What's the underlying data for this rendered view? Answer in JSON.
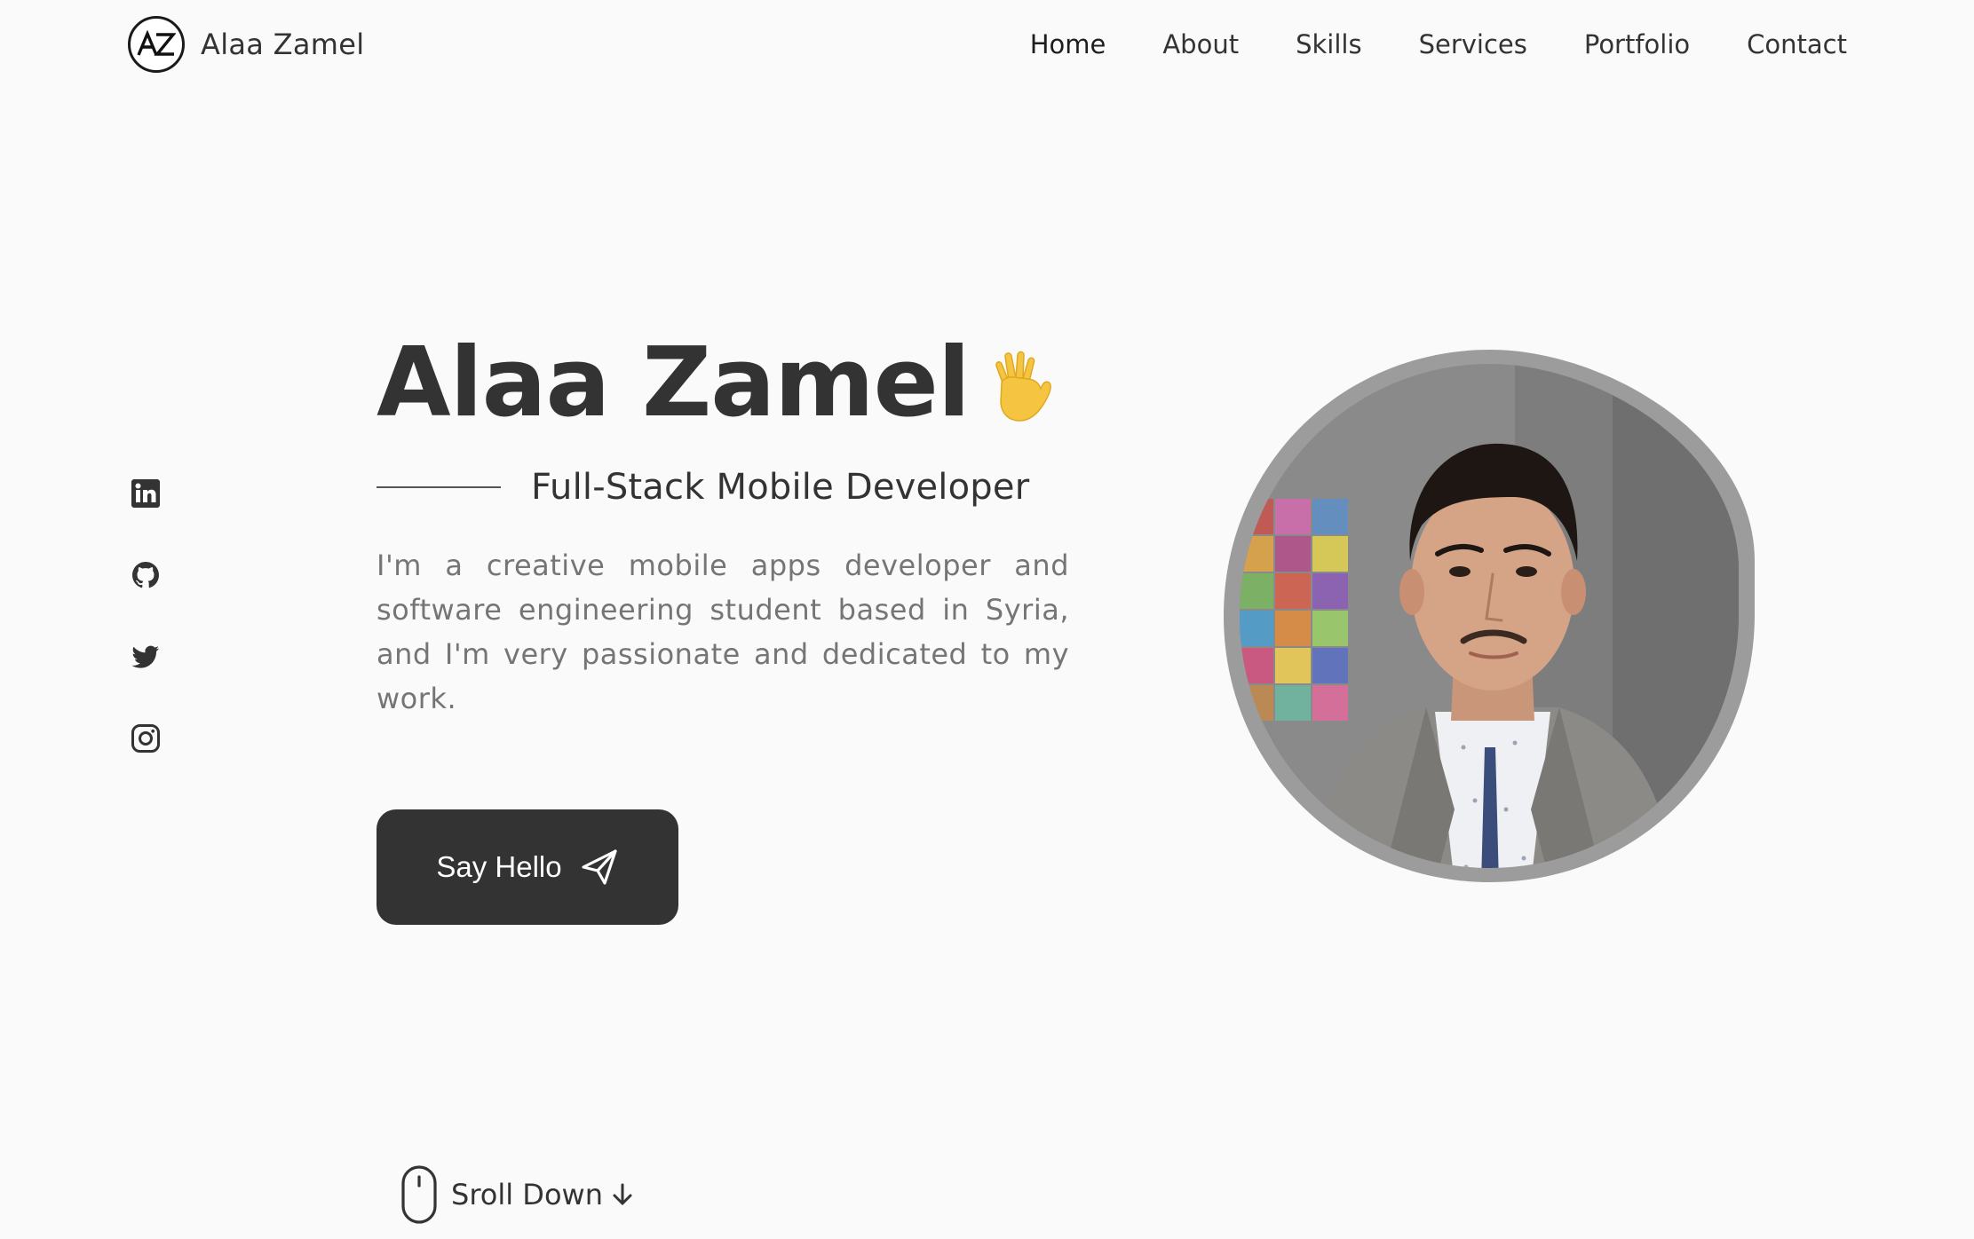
{
  "brand": {
    "logo_text": "AZ",
    "name": "Alaa Zamel"
  },
  "nav": {
    "items": [
      {
        "label": "Home",
        "active": true
      },
      {
        "label": "About",
        "active": false
      },
      {
        "label": "Skills",
        "active": false
      },
      {
        "label": "Services",
        "active": false
      },
      {
        "label": "Portfolio",
        "active": false
      },
      {
        "label": "Contact",
        "active": false
      }
    ]
  },
  "social": {
    "icons": [
      "linkedin-icon",
      "github-icon",
      "twitter-icon",
      "instagram-icon"
    ]
  },
  "hero": {
    "name": "Alaa Zamel",
    "wave_icon": "waving-hand-icon",
    "subtitle": "Full-Stack Mobile Developer",
    "description": "I'm a creative mobile apps developer and software engineering student based in Syria, and I'm very passionate and dedicated to my work.",
    "button_label": "Say Hello",
    "button_icon": "send-icon"
  },
  "scroll": {
    "label": "Sroll Down",
    "icon": "mouse-icon"
  },
  "colors": {
    "background": "#fafafa",
    "text": "#333333",
    "muted_text": "#757575",
    "button": "#333333",
    "wave": "#f5c542"
  }
}
